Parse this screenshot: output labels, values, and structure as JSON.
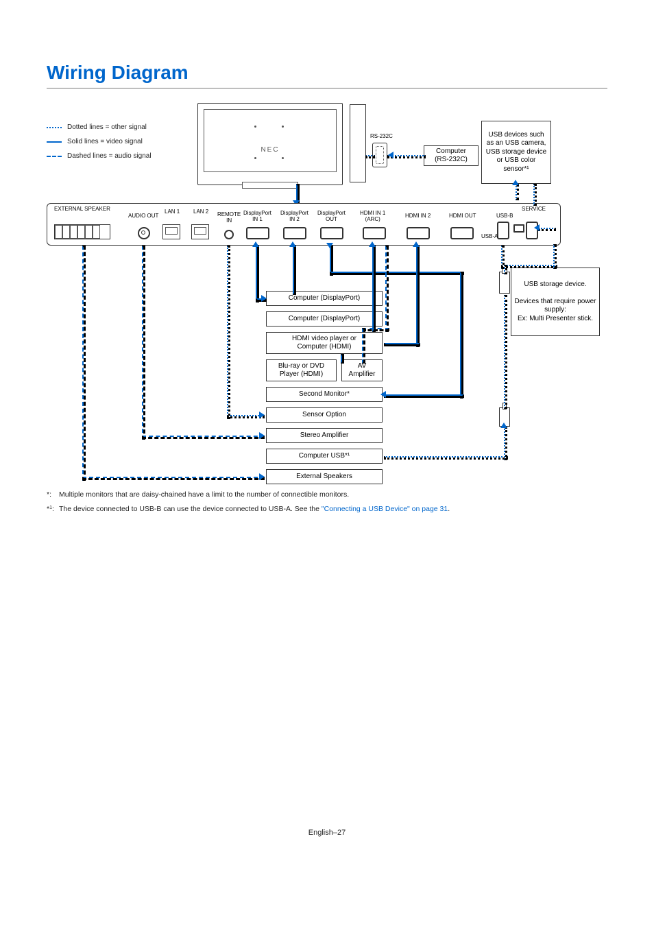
{
  "title": "Wiring Diagram",
  "legend": {
    "dotted": "Dotted lines = other signal",
    "solid": "Solid lines = video signal",
    "dashed": "Dashed lines = audio signal"
  },
  "monitor_logo": "NEC",
  "rs232c_label": "RS-232C",
  "computer_rs232c": "Computer\n(RS-232C)",
  "usb_devices_box": "USB devices such as an USB camera, USB storage device or USB color sensor*¹",
  "ports": {
    "external_speaker": "EXTERNAL SPEAKER",
    "audio_out": "AUDIO OUT",
    "lan1": "LAN 1",
    "lan2": "LAN 2",
    "remote_in": "REMOTE\nIN",
    "dp_in1": "DisplayPort\nIN 1",
    "dp_in2": "DisplayPort\nIN 2",
    "dp_out": "DisplayPort\nOUT",
    "hdmi_in1": "HDMI IN 1\n(ARC)",
    "hdmi_in2": "HDMI IN 2",
    "hdmi_out": "HDMI OUT",
    "usb_b": "USB-B",
    "usb_a": "USB-A",
    "service": "SERVICE"
  },
  "boxes": {
    "computer_dp1": "Computer (DisplayPort)",
    "computer_dp2": "Computer (DisplayPort)",
    "hdmi_player": "HDMI video player or\nComputer (HDMI)",
    "bluray": "Blu-ray or DVD\nPlayer (HDMI)",
    "av_amp": "AV\nAmplifier",
    "second_monitor": "Second Monitor*",
    "sensor_option": "Sensor Option",
    "stereo_amp": "Stereo Amplifier",
    "computer_usb": "Computer USB*¹",
    "external_speakers": "External Speakers",
    "usb_storage": "USB storage device.\n\nDevices that require power supply:\nEx: Multi Presenter stick."
  },
  "footnotes": {
    "f1_mark": "*:",
    "f1": "Multiple monitors that are daisy-chained have a limit to the number of connectible monitors.",
    "f2_mark": "*¹:",
    "f2_a": "The device connected to USB-B can use the device connected to USB-A. See the ",
    "f2_link": "\"Connecting a USB Device\" on page 31",
    "f2_b": "."
  },
  "page_footer": "English–27"
}
